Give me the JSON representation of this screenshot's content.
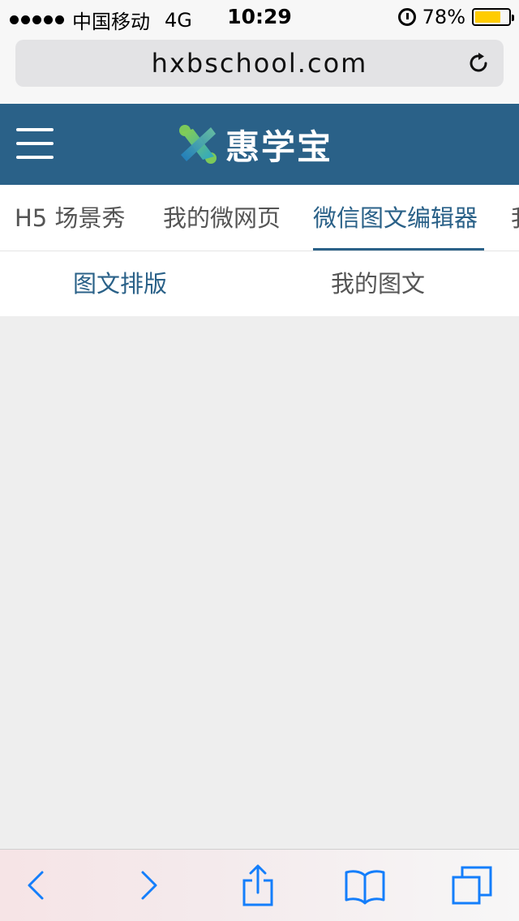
{
  "status_bar": {
    "carrier": "中国移动",
    "network": "4G",
    "time": "10:29",
    "battery": "78%",
    "battery_level": 0.78,
    "icons": [
      "signal-dots",
      "alarm-icon",
      "battery-icon"
    ]
  },
  "browser": {
    "url": "hxbschool.com",
    "reload_icon": "reload-icon"
  },
  "header": {
    "logo_text": "惠学宝",
    "menu_icon": "hamburger-menu-icon"
  },
  "main_tabs": [
    {
      "label": "H5 场景秀",
      "active": false
    },
    {
      "label": "我的微网页",
      "active": false
    },
    {
      "label": "微信图文编辑器",
      "active": true
    },
    {
      "label": "我",
      "active": false
    }
  ],
  "sub_tabs": [
    {
      "label": "图文排版",
      "active": true
    },
    {
      "label": "我的图文",
      "active": false
    }
  ],
  "toolbar": {
    "icons": [
      "back-icon",
      "forward-icon",
      "share-icon",
      "bookmarks-icon",
      "tabs-icon"
    ]
  },
  "colors": {
    "brand": "#2a6188",
    "accent_blue": "#147efb",
    "battery": "#ffcc00"
  }
}
